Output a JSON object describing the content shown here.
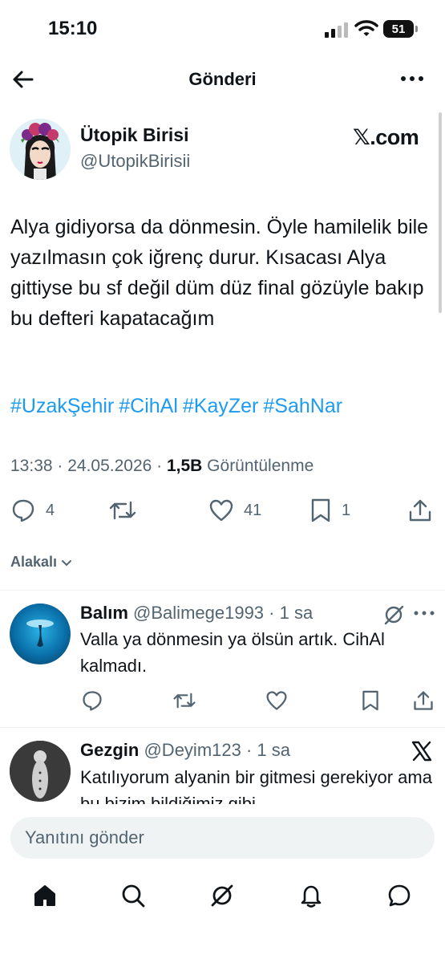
{
  "status_bar": {
    "time": "15:10",
    "battery": "51"
  },
  "header": {
    "title": "Gönderi"
  },
  "tweet": {
    "author_name": "Ütopik Birisi",
    "author_handle": "@UtopikBirisii",
    "source_label": "𝕏.com",
    "text": "Alya gidiyorsa da dönmesin. Öyle hamilelik bile yazılmasın çok iğrenç durur. Kısacası Alya gittiyse bu sf değil düm düz final gözüyle bakıp bu defteri kapatacağım",
    "hashtags": [
      "#UzakŞehir",
      "#CihAl",
      "#KayZer",
      "#SahNar"
    ],
    "timestamp": "13:38 · 24.05.2026 · ",
    "views_count": "1,5B",
    "views_label": " Görüntülenme",
    "replies": "4",
    "likes": "41",
    "bookmarks": "1"
  },
  "related_label": "Alakalı",
  "replies": [
    {
      "name": "Balım",
      "handle": "@Balimege1993",
      "time": " · 1 sa",
      "text": "Valla ya dönmesin ya ölsün artık. CihAl kalmadı."
    },
    {
      "name": "Gezgin",
      "handle": "@Deyim123",
      "time": " · 1 sa",
      "text": "Katılıyorum alyanin bir gitmesi gerekiyor ama bu bizim bildiğimiz gibi"
    }
  ],
  "composer": {
    "placeholder": "Yanıtını gönder"
  },
  "colors": {
    "accent": "#1d9bf0",
    "muted": "#536471",
    "text": "#0f1419"
  }
}
